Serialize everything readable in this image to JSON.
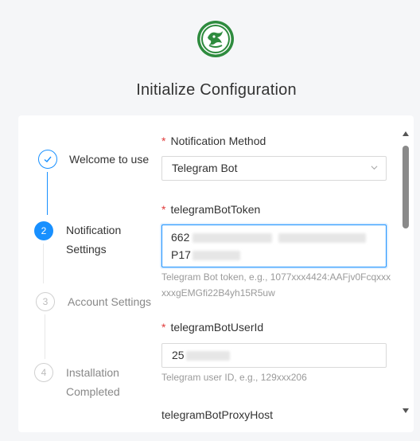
{
  "page": {
    "title": "Initialize Configuration"
  },
  "steps": [
    {
      "index": "1",
      "title": "Welcome to use",
      "status": "finish"
    },
    {
      "index": "2",
      "title": "Notification Settings",
      "status": "process"
    },
    {
      "index": "3",
      "title": "Account Settings",
      "status": "wait"
    },
    {
      "index": "4",
      "title": "Installation Completed",
      "status": "wait"
    }
  ],
  "step_icons": {
    "finish": "check-icon"
  },
  "form": {
    "notification_method": {
      "required_mark": "*",
      "label": "Notification Method",
      "value": "Telegram Bot"
    },
    "bot_token": {
      "required_mark": "*",
      "label": "telegramBotToken",
      "value_line1": "662",
      "value_line2": "P17",
      "help": "Telegram Bot token, e.g., 1077xxx4424:AAFjv0FcqxxxxxxgEMGfi22B4yh15R5uw"
    },
    "bot_user_id": {
      "required_mark": "*",
      "label": "telegramBotUserId",
      "value": "25",
      "help": "Telegram user ID, e.g., 129xxx206"
    },
    "bot_proxy_host": {
      "label": "telegramBotProxyHost"
    }
  },
  "colors": {
    "primary": "#1890ff",
    "required": "#e03b3b",
    "logo_green": "#2e8b3e"
  }
}
